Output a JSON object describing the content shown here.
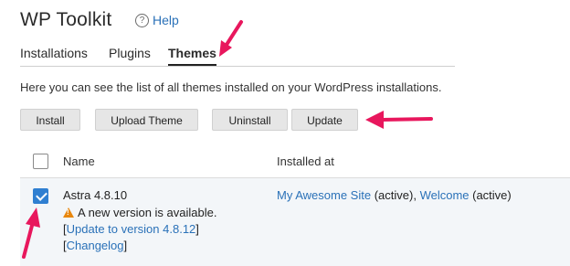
{
  "header": {
    "title": "WP Toolkit",
    "help_label": "Help",
    "help_icon": "question-circle-icon"
  },
  "tabs": [
    {
      "label": "Installations",
      "active": false
    },
    {
      "label": "Plugins",
      "active": false
    },
    {
      "label": "Themes",
      "active": true
    }
  ],
  "description": "Here you can see the list of all themes installed on your WordPress installations.",
  "toolbar": {
    "install": "Install",
    "upload_theme": "Upload Theme",
    "uninstall": "Uninstall",
    "update": "Update"
  },
  "table": {
    "columns": {
      "name": "Name",
      "installed_at": "Installed at"
    },
    "rows": [
      {
        "checked": true,
        "name": "Astra 4.8.10",
        "warning": "A new version is available.",
        "update_link": "Update to version 4.8.12",
        "changelog_link": "Changelog",
        "site1": "My Awesome Site",
        "site1_state": " (active), ",
        "site2": "Welcome",
        "site2_state": " (active)"
      }
    ]
  },
  "colors": {
    "accent": "#2a71b8",
    "annotation_arrow": "#e8175d",
    "warning": "#e8870d"
  }
}
